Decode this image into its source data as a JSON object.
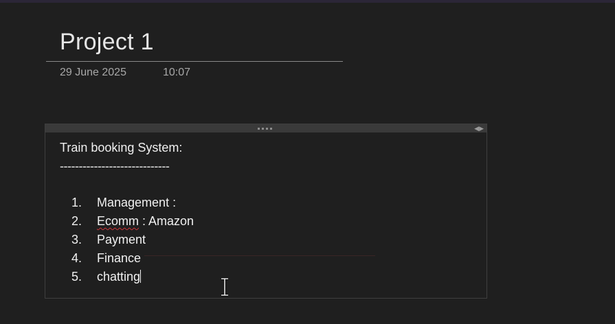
{
  "page": {
    "title": "Project 1",
    "date": "29 June 2025",
    "time": "10:07"
  },
  "note": {
    "heading": "Train booking System:",
    "dashes": "-----------------------------",
    "items": [
      {
        "number": "1.",
        "text": "Management :"
      },
      {
        "number": "2.",
        "misspelled": "Ecomm",
        "text": " : Amazon"
      },
      {
        "number": "3.",
        "text": "Payment"
      },
      {
        "number": "4.",
        "text": "Finance"
      },
      {
        "number": "5.",
        "text": "chatting"
      }
    ]
  },
  "icons": {
    "drag_handle": "drag-dots-icon",
    "resize": "resize-arrows-icon",
    "cursor": "text-ibeam-cursor-icon"
  },
  "colors": {
    "background": "#1f1f1f",
    "text": "#f0f0f0",
    "spell_error": "#d13438"
  }
}
